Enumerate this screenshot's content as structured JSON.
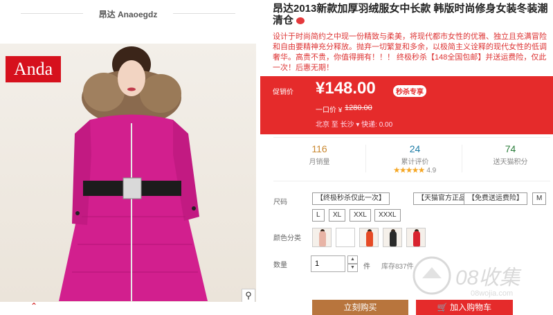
{
  "store": {
    "title": "昂达 Anaoegdz",
    "logo_text": "Anda"
  },
  "product": {
    "title_line1": "昂达2013新款加厚羽绒服女中长款 韩版时尚修身女装冬装潮",
    "title_line2": "清仓",
    "description": "设计于时尚简约之中现一份精致与柔美，将现代都市女性的优雅、独立且充满冒险和自由要精神充分释放。抛弃一切繁复和多余，以极简主义诠释的现代女性的低调奢华。高贵不贵，你值得拥有！！！ 终极秒杀【148全国包邮】并送运费险，仅此一次！后惠无期！"
  },
  "price": {
    "label": "促销价",
    "value": "¥148.00",
    "badge": "秒杀专享",
    "orig_label": "一口价 ¥",
    "orig_value": "1280.00",
    "ship_text": "北京  至  长沙 ▾  快递: 0.00"
  },
  "stats": {
    "sales_num": "116",
    "sales_label": "月销量",
    "reviews_num": "24",
    "reviews_label": "累计评价",
    "rating_stars": "★★★★★",
    "rating_value": "4.9",
    "points_num": "74",
    "points_label": "送天猫积分"
  },
  "size": {
    "label": "尺码",
    "options": [
      "【终极秒杀仅此一次】",
      "【天猫官方正品】",
      "【免费送运费险】",
      "M",
      "L",
      "XL",
      "XXL",
      "XXXL"
    ]
  },
  "color": {
    "label": "颜色分类"
  },
  "quantity": {
    "label": "数量",
    "value": "1",
    "unit": "件",
    "stock": "库存837件"
  },
  "buttons": {
    "buy": "立刻购买",
    "cart": "加入购物车"
  },
  "watermark": {
    "text": "08收集",
    "sub": "08wojia.com"
  },
  "colors": {
    "accent_red": "#e52b2b",
    "buy_brown": "#b8753d",
    "coat_pink": "#d21f8e",
    "stat_green": "#2a7d3a",
    "stat_blue": "#1a7aa5",
    "stat_orange": "#c9872f"
  }
}
